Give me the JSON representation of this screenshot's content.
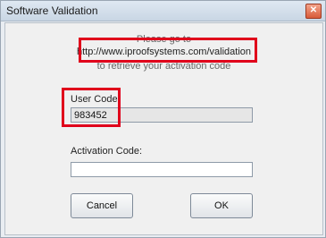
{
  "window": {
    "title": "Software Validation",
    "close_glyph": "✕"
  },
  "message": {
    "line1": "Please go to",
    "line2": "http://www.iproofsystems.com/validation",
    "line3": "to retrieve your activation code"
  },
  "user_code": {
    "label": "User Code:",
    "value": "983452"
  },
  "activation_code": {
    "label": "Activation Code:",
    "value": ""
  },
  "buttons": {
    "cancel": "Cancel",
    "ok": "OK"
  },
  "colors": {
    "highlight": "#e0001b"
  }
}
